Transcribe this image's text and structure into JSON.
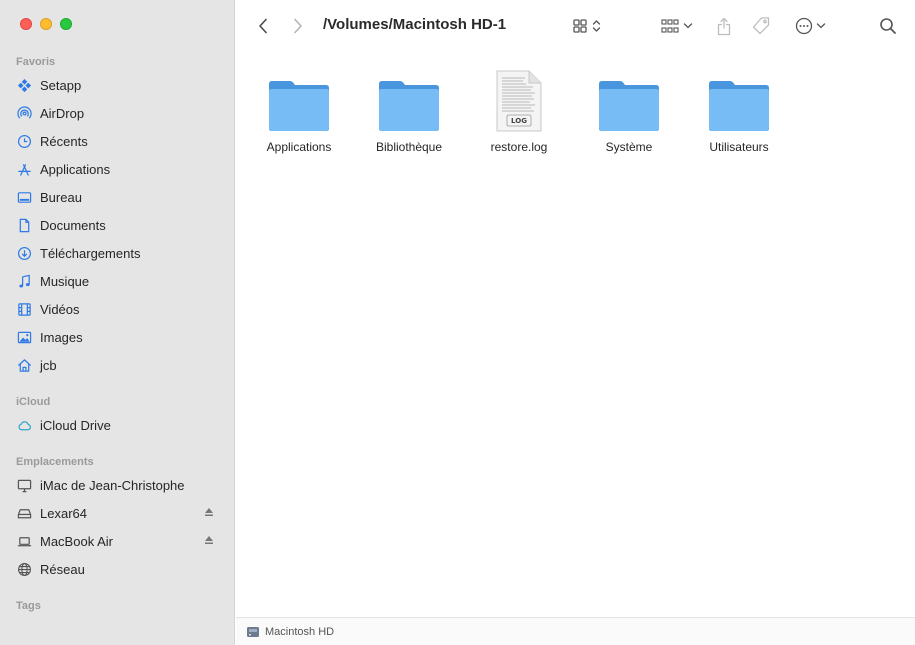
{
  "window": {
    "path_title": "/Volumes/Macintosh HD-1",
    "accent_color": "#2f7ae5",
    "folder_color": "#6cb3f0"
  },
  "sidebar": {
    "favorites_title": "Favoris",
    "favorites": [
      {
        "label": "Setapp",
        "icon": "setapp-icon"
      },
      {
        "label": "AirDrop",
        "icon": "airdrop-icon"
      },
      {
        "label": "Récents",
        "icon": "clock-icon"
      },
      {
        "label": "Applications",
        "icon": "applications-icon"
      },
      {
        "label": "Bureau",
        "icon": "desktop-icon"
      },
      {
        "label": "Documents",
        "icon": "document-icon"
      },
      {
        "label": "Téléchargements",
        "icon": "download-icon"
      },
      {
        "label": "Musique",
        "icon": "music-icon"
      },
      {
        "label": "Vidéos",
        "icon": "film-icon"
      },
      {
        "label": "Images",
        "icon": "photo-icon"
      },
      {
        "label": "jcb",
        "icon": "home-icon"
      }
    ],
    "icloud_title": "iCloud",
    "icloud": [
      {
        "label": "iCloud Drive",
        "icon": "cloud-icon"
      }
    ],
    "locations_title": "Emplacements",
    "locations": [
      {
        "label": "iMac de Jean-Christophe",
        "icon": "imac-icon"
      },
      {
        "label": "Lexar64",
        "icon": "external-drive-icon"
      },
      {
        "label": "MacBook Air",
        "icon": "laptop-icon"
      },
      {
        "label": "Réseau",
        "icon": "network-icon"
      }
    ],
    "tags_title": "Tags"
  },
  "content": {
    "items": [
      {
        "name": "Applications",
        "type": "folder"
      },
      {
        "name": "Bibliothèque",
        "type": "folder"
      },
      {
        "name": "restore.log",
        "type": "file",
        "badge": "LOG"
      },
      {
        "name": "Système",
        "type": "folder"
      },
      {
        "name": "Utilisateurs",
        "type": "folder"
      }
    ]
  },
  "statusbar": {
    "label": "Macintosh HD"
  }
}
